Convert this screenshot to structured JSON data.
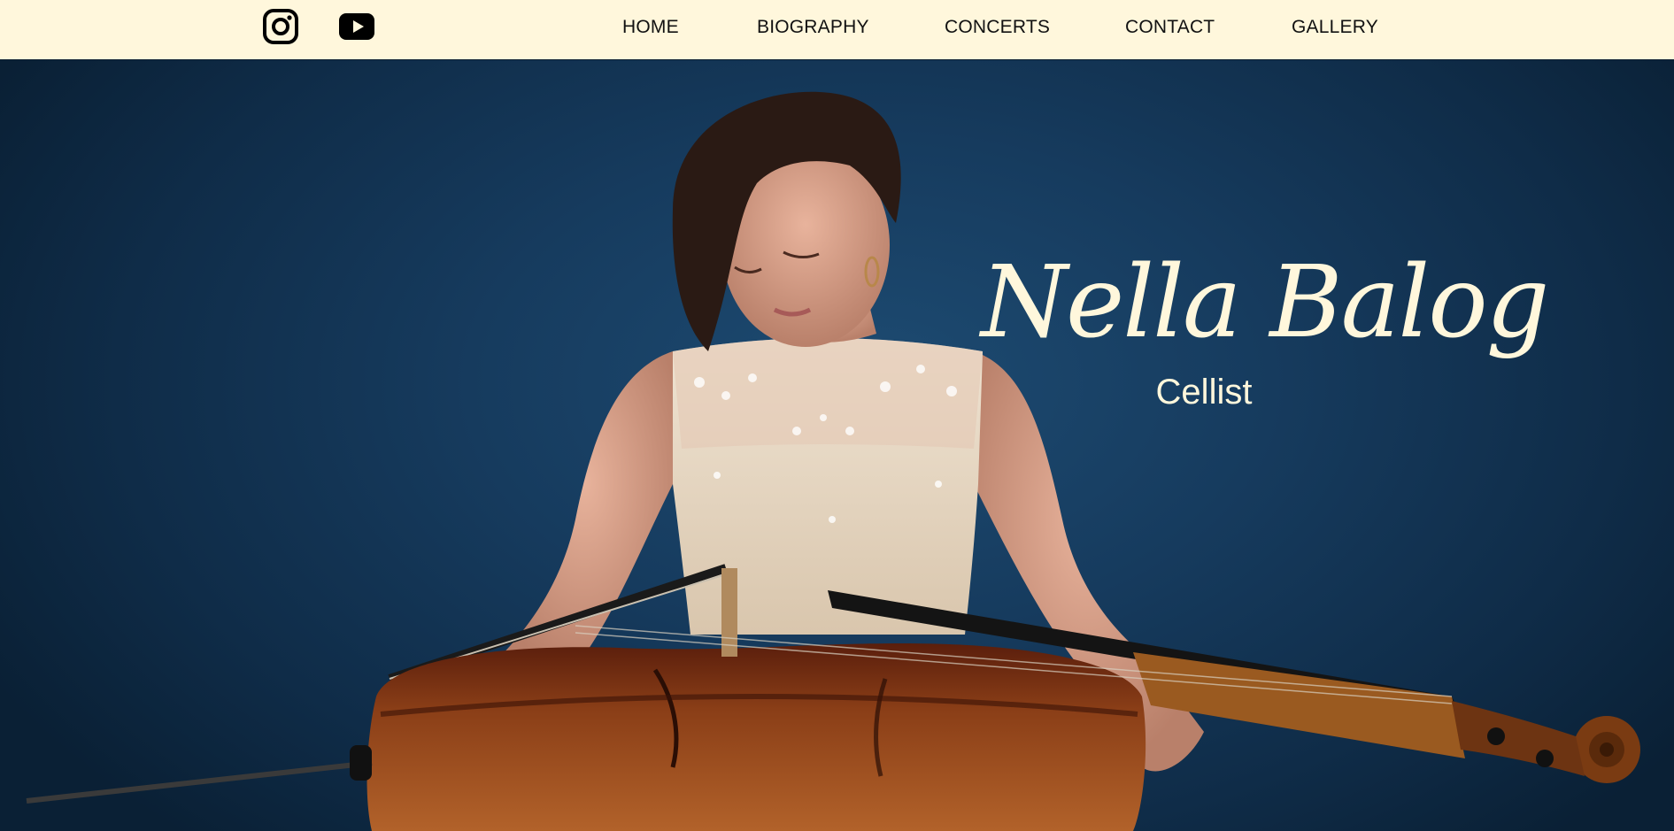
{
  "header": {
    "social": [
      {
        "icon": "instagram-icon"
      },
      {
        "icon": "youtube-icon"
      }
    ],
    "nav": [
      {
        "label": "HOME"
      },
      {
        "label": "BIOGRAPHY"
      },
      {
        "label": "CONCERTS"
      },
      {
        "label": "CONTACT"
      },
      {
        "label": "GALLERY"
      }
    ]
  },
  "hero": {
    "name": "Nella Balog",
    "subtitle": "Cellist"
  },
  "colors": {
    "header_bg": "#fff7dc",
    "hero_bg": "#163b5e",
    "hero_text": "#fff7dc",
    "nav_text": "#111111"
  }
}
